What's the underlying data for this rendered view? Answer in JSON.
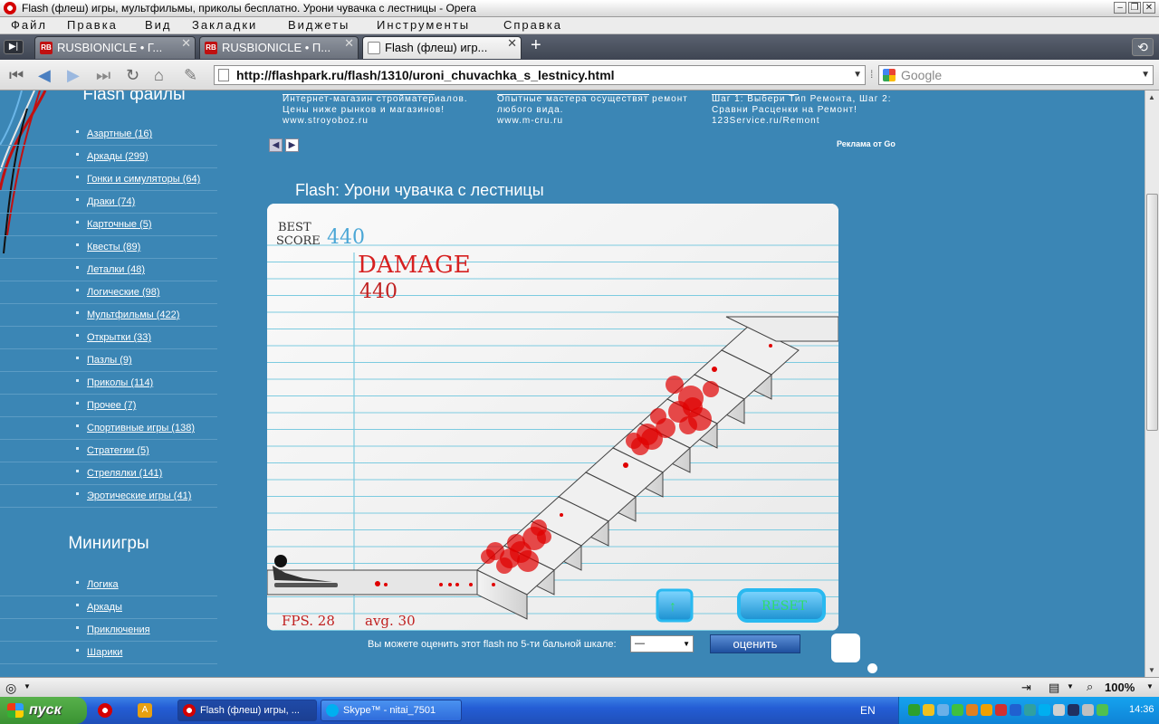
{
  "window": {
    "title": "Flash (флеш) игры, мультфильмы, приколы бесплатно. Урони чувачка с лестницы - Opera"
  },
  "menu": [
    "Файл",
    "Правка",
    "Вид",
    "Закладки",
    "Виджеты",
    "Инструменты",
    "Справка"
  ],
  "tabs": [
    {
      "label": "RUSBIONICLE • Г..."
    },
    {
      "label": "RUSBIONICLE • П..."
    },
    {
      "label": "Flash (флеш) игр..."
    }
  ],
  "address": {
    "url": "http://flashpark.ru/flash/1310/uroni_chuvachka_s_lestnicy.html",
    "search_placeholder": "Google"
  },
  "sidebar": {
    "flash_heading": "Flash файлы",
    "categories": [
      "Азартные (16)",
      "Аркады (299)",
      "Гонки и симуляторы (64)",
      "Драки (74)",
      "Карточные (5)",
      "Квесты (89)",
      "Леталки (48)",
      "Логические (98)",
      "Мультфильмы (422)",
      "Открытки (33)",
      "Пазлы (9)",
      "Приколы (114)",
      "Прочее (7)",
      "Спортивные игры (138)",
      "Стратегии (5)",
      "Стрелялки (141)",
      "Эротические игры (41)"
    ],
    "mini_heading": "Миниигры",
    "mini_categories": [
      "Логика",
      "Аркады",
      "Приключения",
      "Шарики"
    ]
  },
  "ads": [
    {
      "line1": "Интернет-магазин стройматериалов.",
      "line2": "Цены ниже рынков и магазинов!",
      "url": "www.stroyoboz.ru"
    },
    {
      "line1": "Опытные мастера осуществят ремонт",
      "line2": "любого вида.",
      "url": "www.m-cru.ru"
    },
    {
      "line1": "Шаг 1: Выбери Тип Ремонта, Шаг 2:",
      "line2": "Сравни Расценки на Ремонт!",
      "url": "123Service.ru/Remont"
    }
  ],
  "ad_credit": "Реклама от Go",
  "game": {
    "title": "Flash: Урони чувачка с лестницы",
    "best_label_1": "BEST",
    "best_label_2": "SCORE",
    "best_score": "440",
    "damage_label": "DAMAGE",
    "damage_value": "440",
    "fps": "FPS. 28",
    "avg": "avg. 30",
    "reset_label": "RESET"
  },
  "rating": {
    "prompt": "Вы можете оценить этот flash по 5-ти бальной шкале:",
    "selected": "—",
    "button": "оценить"
  },
  "status": {
    "zoom": "100%"
  },
  "taskbar": {
    "start": "пуск",
    "items": [
      "Flash (флеш) игры, ...",
      "Skype™ - nitai_7501"
    ],
    "lang": "EN",
    "clock": "14:36"
  },
  "colors": {
    "page_bg": "#3b86b5",
    "paper_line": "#7ccbe0",
    "damage_red": "#d62020",
    "blood": "#e00000"
  }
}
